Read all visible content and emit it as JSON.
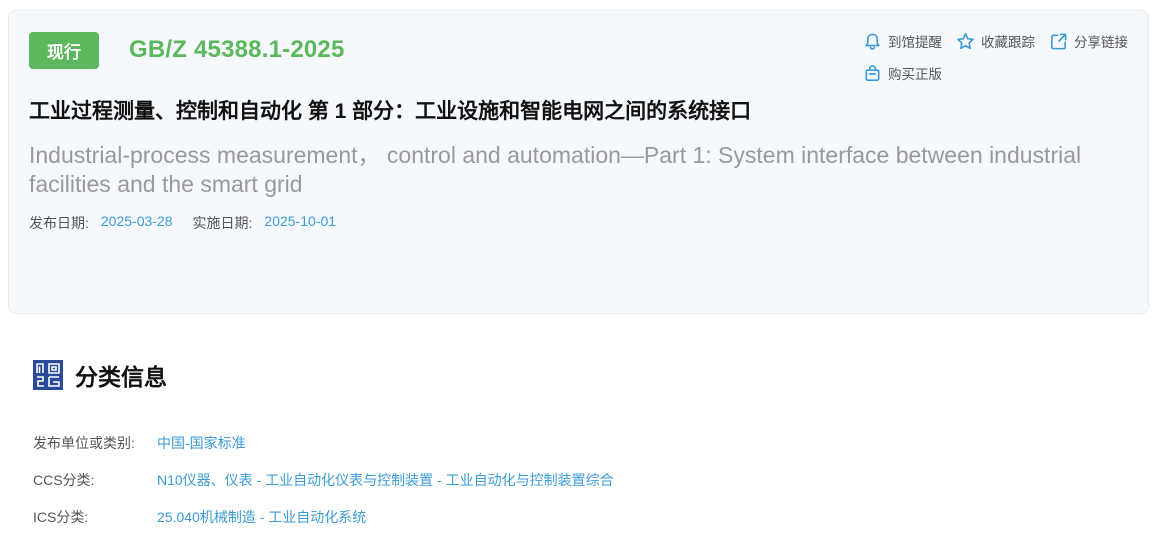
{
  "standard": {
    "status": "现行",
    "number": "GB/Z 45388.1-2025",
    "title_cn": "工业过程测量、控制和自动化 第 1 部分：工业设施和智能电网之间的系统接口",
    "title_en": "Industrial-process measurement， control and automation—Part 1: System interface between industrial facilities and the smart grid",
    "publish_label": "发布日期:",
    "publish_date": "2025-03-28",
    "effective_label": "实施日期:",
    "effective_date": "2025-10-01"
  },
  "actions": {
    "remind": "到馆提醒",
    "favorite": "收藏跟踪",
    "share": "分享链接",
    "buy": "购买正版"
  },
  "classification": {
    "title": "分类信息",
    "rows": [
      {
        "key": "发布单位或类别:",
        "value": "中国-国家标准"
      },
      {
        "key": "CCS分类:",
        "value": "N10仪器、仪表 - 工业自动化仪表与控制装置 - 工业自动化与控制装置综合"
      },
      {
        "key": "ICS分类:",
        "value": "25.040机械制造 - 工业自动化系统"
      }
    ]
  },
  "colors": {
    "accent_green": "#5cb85c",
    "link_blue": "#3b9bd5",
    "card_bg": "#f5f8fc"
  }
}
